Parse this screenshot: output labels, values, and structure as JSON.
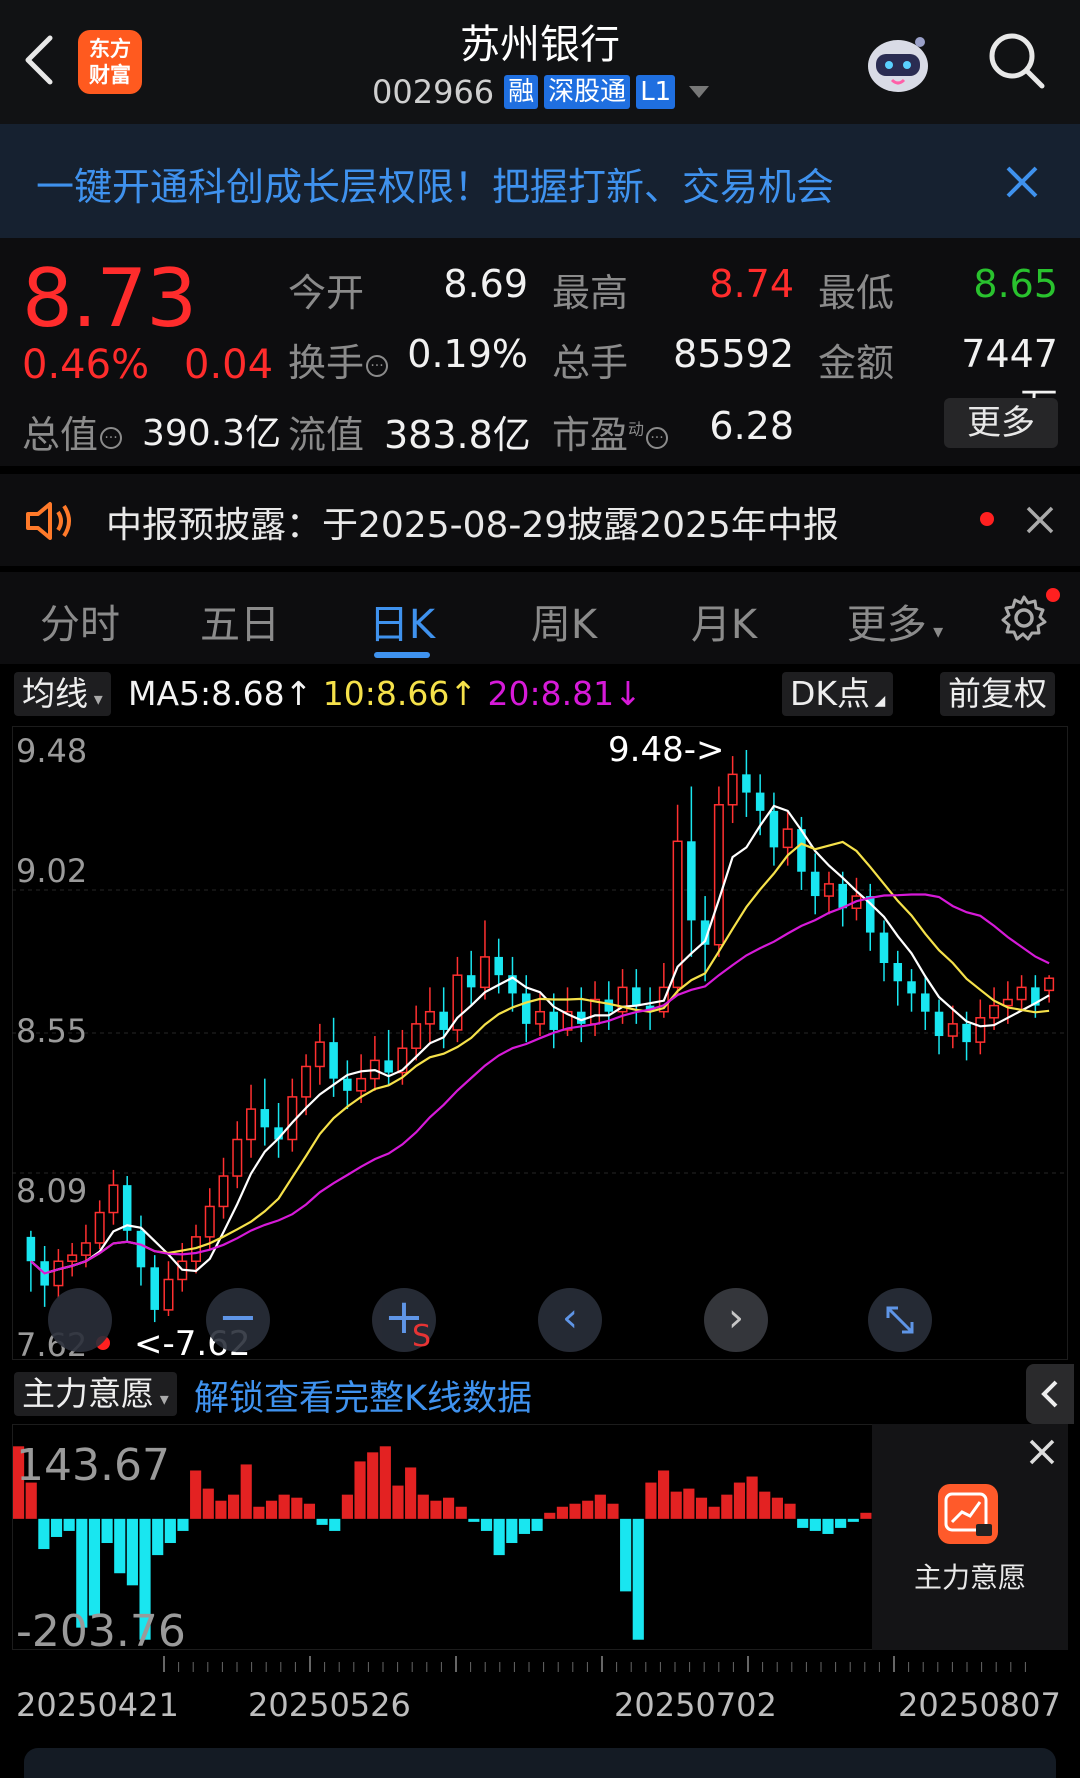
{
  "header": {
    "logo_text_1": "东方",
    "logo_text_2": "财富",
    "stock_name": "苏州银行",
    "stock_code": "002966",
    "tags": [
      "融",
      "深股通",
      "L1"
    ],
    "back_icon": "chevron-left-icon",
    "robot_icon": "robot-assistant-icon",
    "search_icon": "search-icon"
  },
  "banner": {
    "text": "一键开通科创成长层权限！把握打新、交易机会",
    "close_icon": "close-icon"
  },
  "quote": {
    "price": "8.73",
    "change_pct": "0.46%",
    "change": "0.04",
    "rows": [
      [
        {
          "label": "今开",
          "value": "8.69"
        },
        {
          "label": "最高",
          "value": "8.74",
          "color": "red"
        },
        {
          "label": "最低",
          "value": "8.65",
          "color": "green"
        }
      ],
      [
        {
          "label": "换手",
          "value": "0.19%"
        },
        {
          "label": "总手",
          "value": "85592"
        },
        {
          "label": "金额",
          "value": "7447万"
        }
      ]
    ],
    "total_value_label": "总值",
    "total_value": "390.3亿",
    "float_value_label": "流值",
    "float_value": "383.8亿",
    "pe_label": "市盈",
    "pe_sup": "动",
    "pe_value": "6.28",
    "more_label": "更多"
  },
  "notice": {
    "text": "中报预披露：于2025-08-29披露2025年中报",
    "icon": "speaker-icon"
  },
  "tabs": {
    "items": [
      "分时",
      "五日",
      "日K",
      "周K",
      "月K",
      "更多"
    ],
    "active": "日K",
    "settings_icon": "gear-icon"
  },
  "ma_bar": {
    "selector": "均线",
    "ma5": "MA5:8.68",
    "ma10": "10:8.66",
    "ma20": "20:8.81",
    "dk_label": "DK点",
    "adjust_label": "前复权"
  },
  "chart_data": {
    "type": "candlestick",
    "y_ticks": [
      "9.48",
      "9.02",
      "8.55",
      "8.09",
      "7.62"
    ],
    "ylim": [
      7.62,
      9.48
    ],
    "high_marker": "9.48->",
    "low_marker": "<-7.62",
    "colors": {
      "up": "#ff3030",
      "down": "#19e6f0",
      "ma5": "#ffffff",
      "ma10": "#f5e14a",
      "ma20": "#d61ad8"
    },
    "candles": [
      [
        7.88,
        7.8,
        7.9,
        7.7
      ],
      [
        7.8,
        7.72,
        7.85,
        7.65
      ],
      [
        7.72,
        7.8,
        7.84,
        7.68
      ],
      [
        7.8,
        7.82,
        7.86,
        7.75
      ],
      [
        7.82,
        7.86,
        7.92,
        7.78
      ],
      [
        7.86,
        7.96,
        8.0,
        7.84
      ],
      [
        7.96,
        8.05,
        8.1,
        7.92
      ],
      [
        8.05,
        7.9,
        8.08,
        7.86
      ],
      [
        7.9,
        7.78,
        7.95,
        7.72
      ],
      [
        7.78,
        7.64,
        7.82,
        7.6
      ],
      [
        7.64,
        7.74,
        7.8,
        7.62
      ],
      [
        7.74,
        7.8,
        7.86,
        7.7
      ],
      [
        7.8,
        7.88,
        7.92,
        7.76
      ],
      [
        7.88,
        7.98,
        8.04,
        7.84
      ],
      [
        7.98,
        8.08,
        8.14,
        7.94
      ],
      [
        8.08,
        8.2,
        8.26,
        8.04
      ],
      [
        8.2,
        8.3,
        8.38,
        8.14
      ],
      [
        8.3,
        8.24,
        8.4,
        8.18
      ],
      [
        8.24,
        8.2,
        8.32,
        8.14
      ],
      [
        8.2,
        8.34,
        8.4,
        8.16
      ],
      [
        8.34,
        8.44,
        8.48,
        8.28
      ],
      [
        8.44,
        8.52,
        8.58,
        8.38
      ],
      [
        8.52,
        8.4,
        8.6,
        8.34
      ],
      [
        8.4,
        8.36,
        8.46,
        8.3
      ],
      [
        8.36,
        8.4,
        8.48,
        8.32
      ],
      [
        8.4,
        8.46,
        8.54,
        8.36
      ],
      [
        8.46,
        8.42,
        8.56,
        8.38
      ],
      [
        8.42,
        8.5,
        8.56,
        8.38
      ],
      [
        8.5,
        8.58,
        8.64,
        8.46
      ],
      [
        8.58,
        8.62,
        8.7,
        8.52
      ],
      [
        8.62,
        8.56,
        8.7,
        8.5
      ],
      [
        8.56,
        8.74,
        8.8,
        8.52
      ],
      [
        8.74,
        8.7,
        8.82,
        8.64
      ],
      [
        8.7,
        8.8,
        8.92,
        8.66
      ],
      [
        8.8,
        8.74,
        8.86,
        8.68
      ],
      [
        8.74,
        8.68,
        8.8,
        8.62
      ],
      [
        8.68,
        8.58,
        8.74,
        8.52
      ],
      [
        8.58,
        8.62,
        8.68,
        8.54
      ],
      [
        8.62,
        8.56,
        8.68,
        8.5
      ],
      [
        8.56,
        8.62,
        8.7,
        8.54
      ],
      [
        8.62,
        8.58,
        8.7,
        8.52
      ],
      [
        8.58,
        8.66,
        8.72,
        8.54
      ],
      [
        8.66,
        8.62,
        8.72,
        8.56
      ],
      [
        8.62,
        8.7,
        8.76,
        8.58
      ],
      [
        8.7,
        8.64,
        8.76,
        8.58
      ],
      [
        8.64,
        8.62,
        8.7,
        8.56
      ],
      [
        8.62,
        8.7,
        8.78,
        8.6
      ],
      [
        8.7,
        9.18,
        9.3,
        8.68
      ],
      [
        9.18,
        8.92,
        9.36,
        8.8
      ],
      [
        8.92,
        8.84,
        9.0,
        8.72
      ],
      [
        8.84,
        9.3,
        9.36,
        8.8
      ],
      [
        9.3,
        9.4,
        9.46,
        9.24
      ],
      [
        9.4,
        9.34,
        9.48,
        9.26
      ],
      [
        9.34,
        9.28,
        9.4,
        9.2
      ],
      [
        9.28,
        9.16,
        9.34,
        9.1
      ],
      [
        9.16,
        9.22,
        9.28,
        9.1
      ],
      [
        9.22,
        9.08,
        9.26,
        9.02
      ],
      [
        9.08,
        9.0,
        9.14,
        8.94
      ],
      [
        9.0,
        9.04,
        9.08,
        8.94
      ],
      [
        9.04,
        8.96,
        9.08,
        8.9
      ],
      [
        8.96,
        9.0,
        9.06,
        8.92
      ],
      [
        9.0,
        8.88,
        9.04,
        8.82
      ],
      [
        8.88,
        8.78,
        8.92,
        8.72
      ],
      [
        8.78,
        8.72,
        8.82,
        8.64
      ],
      [
        8.72,
        8.68,
        8.76,
        8.62
      ],
      [
        8.68,
        8.62,
        8.74,
        8.56
      ],
      [
        8.62,
        8.54,
        8.66,
        8.48
      ],
      [
        8.54,
        8.58,
        8.64,
        8.5
      ],
      [
        8.58,
        8.52,
        8.62,
        8.46
      ],
      [
        8.52,
        8.6,
        8.66,
        8.48
      ],
      [
        8.6,
        8.64,
        8.7,
        8.56
      ],
      [
        8.64,
        8.66,
        8.72,
        8.58
      ],
      [
        8.66,
        8.7,
        8.74,
        8.62
      ],
      [
        8.7,
        8.64,
        8.74,
        8.6
      ],
      [
        8.69,
        8.73,
        8.74,
        8.65
      ]
    ],
    "flow_yticks": [
      "143.67",
      "-203.76"
    ],
    "flow": [
      120,
      60,
      -50,
      -30,
      -20,
      -180,
      -160,
      -40,
      -90,
      -110,
      -200,
      -60,
      -40,
      -20,
      80,
      50,
      30,
      40,
      90,
      20,
      30,
      40,
      35,
      25,
      -10,
      -20,
      40,
      95,
      110,
      120,
      55,
      85,
      40,
      30,
      35,
      20,
      -5,
      -20,
      -60,
      -40,
      -25,
      -20,
      10,
      20,
      25,
      30,
      40,
      25,
      -120,
      -200,
      60,
      80,
      45,
      50,
      35,
      20,
      40,
      60,
      70,
      45,
      35,
      25,
      -15,
      -20,
      -25,
      -15,
      -5,
      10
    ]
  },
  "lower_panel": {
    "selector": "主力意愿",
    "unlock_text": "解锁查看完整K线数据",
    "overlay_label": "主力意愿",
    "overlay_icon": "trend-lock-icon",
    "x_labels": [
      "20250421",
      "20250526",
      "20250702",
      "20250807"
    ]
  }
}
